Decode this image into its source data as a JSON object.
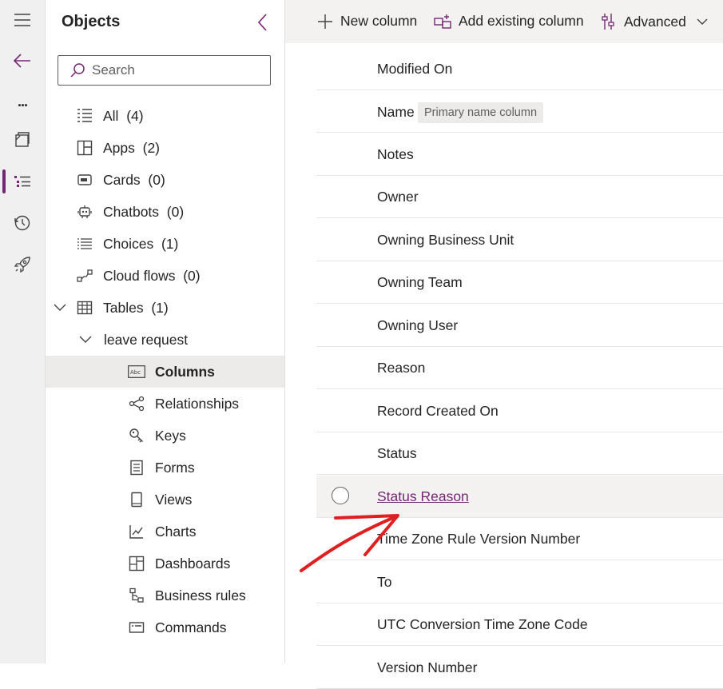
{
  "rail": {
    "items": [
      {
        "icon": "hamburger-menu-icon"
      },
      {
        "icon": "back-arrow-icon"
      },
      {
        "icon": "more-icon",
        "label": "..."
      },
      {
        "icon": "overview-icon"
      },
      {
        "icon": "objects-list-icon",
        "active": true
      },
      {
        "icon": "history-icon"
      },
      {
        "icon": "rocket-icon"
      }
    ],
    "accent": "#742774"
  },
  "objects": {
    "title": "Objects",
    "search_placeholder": "Search",
    "items": [
      {
        "label": "All",
        "count": "(4)",
        "icon": "all-list-icon"
      },
      {
        "label": "Apps",
        "count": "(2)",
        "icon": "apps-icon"
      },
      {
        "label": "Cards",
        "count": "(0)",
        "icon": "cards-icon"
      },
      {
        "label": "Chatbots",
        "count": "(0)",
        "icon": "chatbot-icon"
      },
      {
        "label": "Choices",
        "count": "(1)",
        "icon": "choices-icon"
      },
      {
        "label": "Cloud flows",
        "count": "(0)",
        "icon": "cloud-flows-icon"
      },
      {
        "label": "Tables",
        "count": "(1)",
        "icon": "table-icon",
        "expanded": true
      },
      {
        "label": "leave request",
        "expanded": true
      },
      {
        "label": "Columns",
        "icon": "columns-icon",
        "selected": true
      },
      {
        "label": "Relationships",
        "icon": "relationships-icon"
      },
      {
        "label": "Keys",
        "icon": "keys-icon"
      },
      {
        "label": "Forms",
        "icon": "forms-icon"
      },
      {
        "label": "Views",
        "icon": "views-icon"
      },
      {
        "label": "Charts",
        "icon": "charts-icon"
      },
      {
        "label": "Dashboards",
        "icon": "dashboards-icon"
      },
      {
        "label": "Business rules",
        "icon": "business-rules-icon"
      },
      {
        "label": "Commands",
        "icon": "commands-icon"
      }
    ]
  },
  "commandbar": {
    "new_column": "New column",
    "add_existing_column": "Add existing column",
    "advanced": "Advanced"
  },
  "columns": {
    "rows": [
      {
        "name": "Modified On"
      },
      {
        "name": "Name",
        "badge": "Primary name column"
      },
      {
        "name": "Notes"
      },
      {
        "name": "Owner"
      },
      {
        "name": "Owning Business Unit"
      },
      {
        "name": "Owning Team"
      },
      {
        "name": "Owning User"
      },
      {
        "name": "Reason"
      },
      {
        "name": "Record Created On"
      },
      {
        "name": "Status"
      },
      {
        "name": "Status Reason",
        "hovered": true,
        "link": true
      },
      {
        "name": "Time Zone Rule Version Number"
      },
      {
        "name": "To"
      },
      {
        "name": "UTC Conversion Time Zone Code"
      },
      {
        "name": "Version Number"
      }
    ]
  },
  "annotation": {
    "color": "#e02020"
  }
}
